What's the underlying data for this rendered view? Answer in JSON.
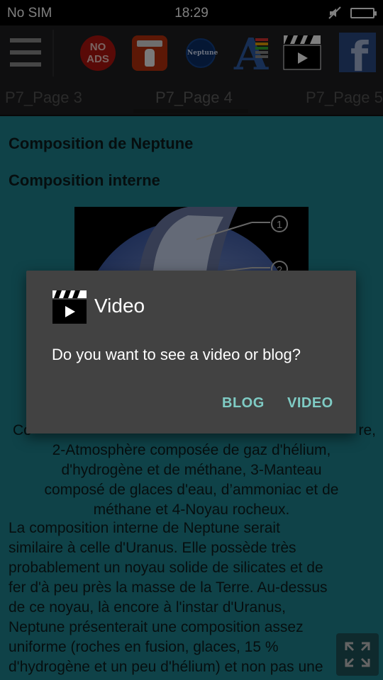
{
  "status_bar": {
    "carrier": "No SIM",
    "time": "18:29",
    "icons": [
      "mute-icon",
      "battery-icon"
    ]
  },
  "toolbar": {
    "icons": [
      "menu-icon",
      "no-ads-icon",
      "console-icon",
      "neptune-icon",
      "font-icon",
      "video-icon",
      "facebook-icon"
    ],
    "no_ads_line1": "NO",
    "no_ads_line2": "ADS",
    "neptune_label": "Neptune",
    "font_letter": "A",
    "facebook_letter": "f"
  },
  "tabs": {
    "items": [
      {
        "label": "P7_Page 3"
      },
      {
        "label": "P7_Page 4",
        "active": true
      },
      {
        "label": "P7_Page 5"
      }
    ]
  },
  "content": {
    "heading1": "Composition de Neptune",
    "heading2": "Composition interne",
    "figure_callouts": [
      "1",
      "2"
    ],
    "caption_line1": "Co",
    "caption_line1_end": "re,",
    "caption_line2": "2-Atmosphère composée de gaz d'hélium,",
    "caption_line3": "d'hydrogène et de méthane, 3-Manteau",
    "caption_line4": "composé de glaces d'eau, d’ammoniac et de",
    "caption_line5": "méthane et 4-Noyau rocheux.",
    "paragraph_lines": [
      "La composition interne de Neptune serait",
      "similaire à celle d'Uranus. Elle possède très",
      "probablement un noyau solide de silicates et de",
      "fer d'à peu près la masse de la Terre. Au-dessus",
      "de ce noyau, là encore à l'instar d'Uranus,",
      "Neptune présenterait une composition assez",
      "uniforme (roches en fusion, glaces, 15 %",
      "d'hydrogène et un peu d'hélium) et non pas une"
    ]
  },
  "dialog": {
    "title": "Video",
    "message": "Do you want to see a video or blog?",
    "buttons": {
      "blog": "BLOG",
      "video": "VIDEO"
    }
  },
  "colors": {
    "content_bg": "#1f8490",
    "dialog_bg": "#424242",
    "dialog_button": "#7fcbc4",
    "toolbar_bg": "#1e1f20"
  }
}
